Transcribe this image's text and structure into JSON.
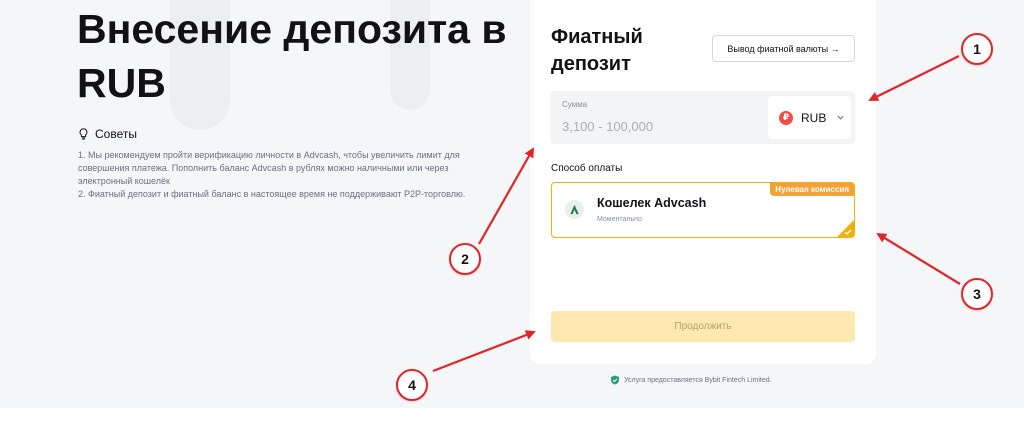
{
  "page": {
    "title": "Внесение депозита в RUB"
  },
  "tips": {
    "heading": "Советы",
    "icon": "lightbulb-icon",
    "items": [
      "1. Мы рекомендуем пройти верификацию личности в Advcash, чтобы увеличить лимит для совершения платежа. Пополнить баланс Advcash в рублях можно наличными или через электронный кошелёк",
      "2. Фиатный депозит и фиатный баланс в настоящее время не поддерживают P2P-торговлю."
    ]
  },
  "card": {
    "title": "Фиатный депозит",
    "withdraw_button": "Вывод фиатной валюты →",
    "amount": {
      "label": "Сумма",
      "value": "",
      "placeholder": "3,100 - 100,000"
    },
    "currency": {
      "symbol": "₽",
      "code": "RUB"
    },
    "payment_method_label": "Способ оплаты",
    "payment_option": {
      "badge": "Нулевая комиссия",
      "name": "Кошелек Advcash",
      "subtitle": "Моментально",
      "selected": true
    },
    "continue_button": "Продолжить"
  },
  "footer": {
    "service_note": "Услуга предоставляется Bybit Fintech Limited."
  },
  "annotations": {
    "markers": [
      "1",
      "2",
      "3",
      "4"
    ]
  },
  "colors": {
    "accent": "#f2b00b",
    "badge": "#f2a236",
    "button_disabled_bg": "#fde9b0",
    "annotation_red": "#e0262a",
    "rub_icon": "#f04f47"
  }
}
